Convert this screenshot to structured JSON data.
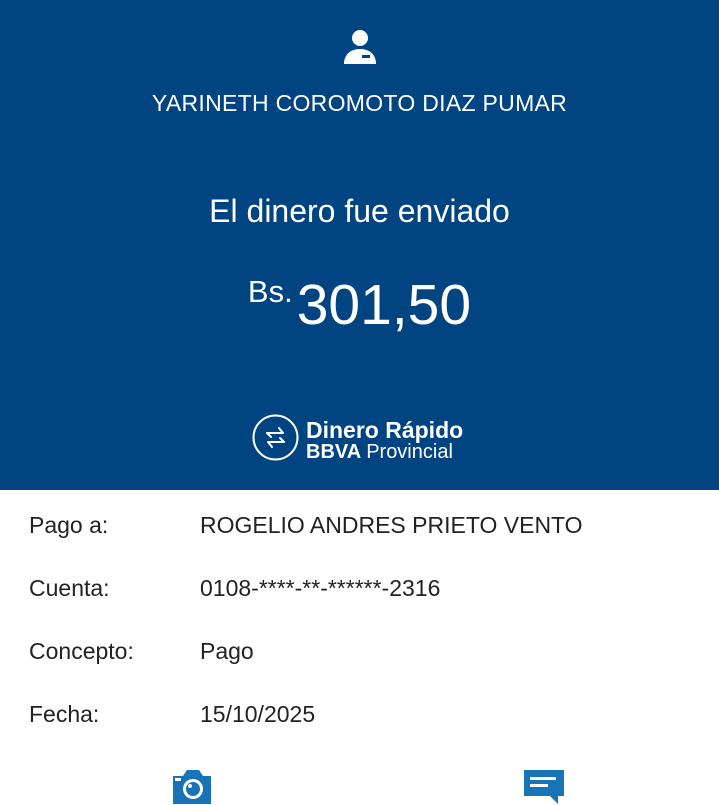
{
  "header": {
    "user_icon": "user-icon",
    "user_name": "YARINETH COROMOTO DIAZ PUMAR",
    "status": "El dinero fue enviado",
    "currency": "Bs.",
    "amount": "301,50",
    "brand": {
      "logo_icon": "transfer-arrows-icon",
      "line1": "Dinero Rápido",
      "line2_bold": "BBVA",
      "line2": "Provincial"
    },
    "background_color": "#004481"
  },
  "details": [
    {
      "label": "Pago a:",
      "value": "ROGELIO ANDRES PRIETO VENTO"
    },
    {
      "label": "Cuenta:",
      "value": "0108-****-**-******-2316"
    },
    {
      "label": "Concepto:",
      "value": "Pago"
    },
    {
      "label": "Fecha:",
      "value": "15/10/2025"
    }
  ],
  "actions": {
    "camera_icon": "camera-icon",
    "message_icon": "chat-icon",
    "icon_color": "#1973b8"
  }
}
